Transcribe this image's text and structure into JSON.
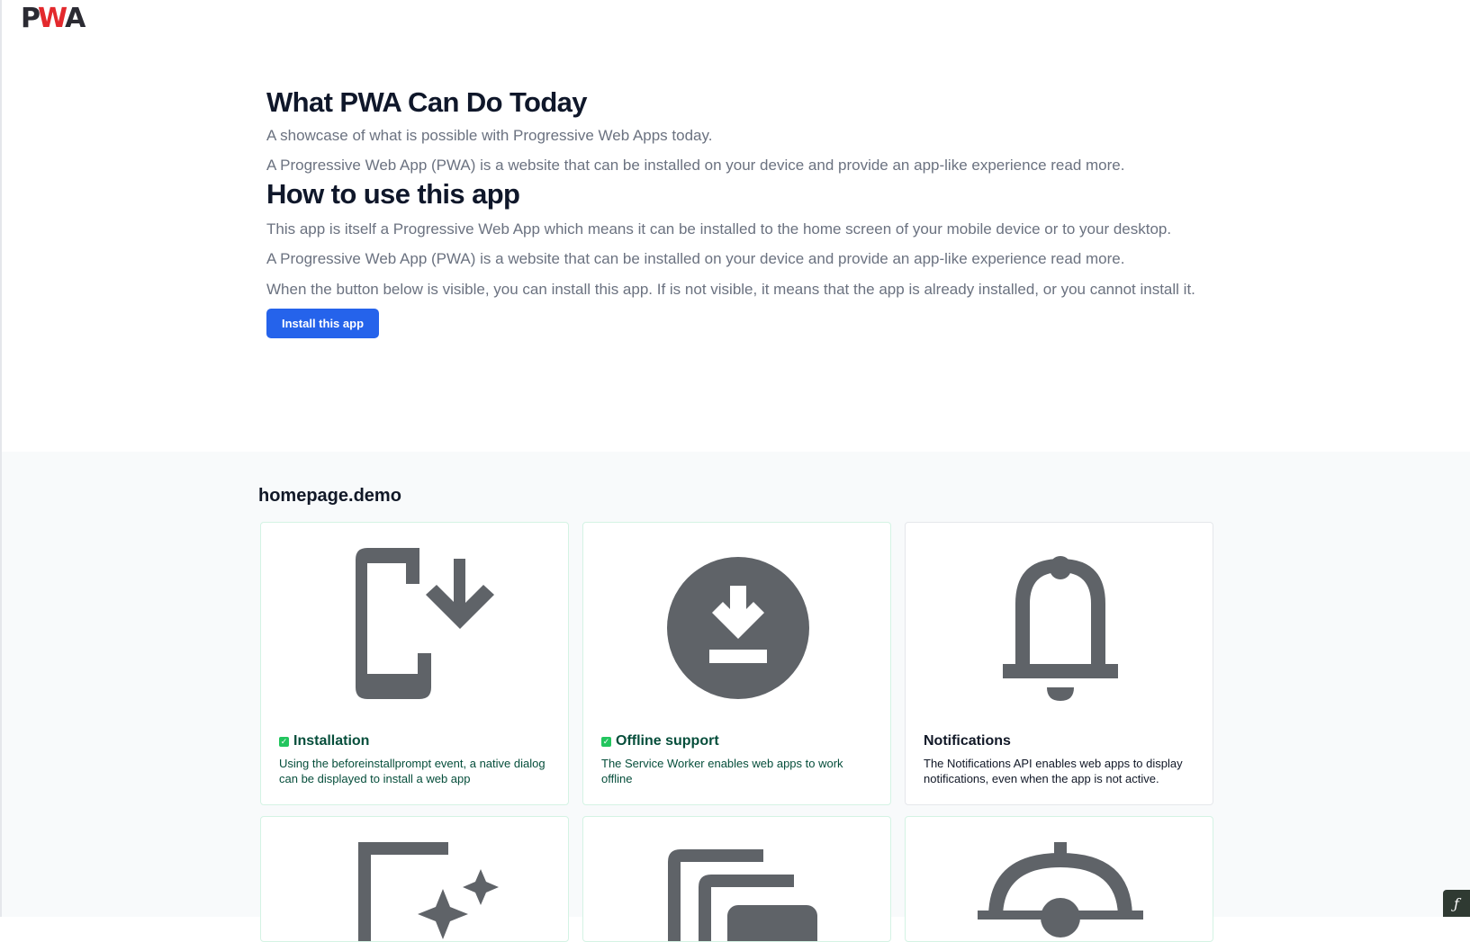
{
  "logo": {
    "text_p": "P",
    "text_w": "W",
    "text_a": "A",
    "colors": {
      "dark": "#2b2b33",
      "red": "#e3292d"
    }
  },
  "hero": {
    "title": "What PWA Can Do Today",
    "subtitle": "A showcase of what is possible with Progressive Web Apps today.",
    "intro": "A Progressive Web App (PWA) is a website that can be installed on your device and provide an app-like experience read more.",
    "how_title": "How to use this app",
    "how_p1": "This app is itself a Progressive Web App which means it can be installed to the home screen of your mobile device or to your desktop.",
    "how_p2": "A Progressive Web App (PWA) is a website that can be installed on your device and provide an app-like experience read more.",
    "how_p3": "When the button below is visible, you can install this app. If is not visible, it means that the app is already installed, or you cannot install it.",
    "install_button": "Install this app"
  },
  "demo": {
    "title": "homepage.demo",
    "cards": [
      {
        "title": "Installation",
        "description": "Using the beforeinstallprompt event, a native dialog can be displayed to install a web app",
        "supported": true,
        "icon": "install-mobile-icon"
      },
      {
        "title": "Offline support",
        "description": "The Service Worker enables web apps to work offline",
        "supported": true,
        "icon": "download-circle-icon"
      },
      {
        "title": "Notifications",
        "description": "The Notifications API enables web apps to display notifications, even when the app is not active.",
        "supported": false,
        "icon": "bell-icon"
      },
      {
        "title": "",
        "description": "",
        "supported": false,
        "icon": "sparkle-window-icon"
      },
      {
        "title": "",
        "description": "",
        "supported": false,
        "icon": "stacked-windows-icon"
      },
      {
        "title": "",
        "description": "",
        "supported": false,
        "icon": "location-icon"
      }
    ]
  },
  "corner_badge": {
    "glyph": "ƒ",
    "icon": "symfony-icon"
  },
  "colors": {
    "accent": "#2563eb",
    "supported_text": "#064e3b",
    "check": "#22c55e",
    "icon_gray": "#5f6368"
  }
}
